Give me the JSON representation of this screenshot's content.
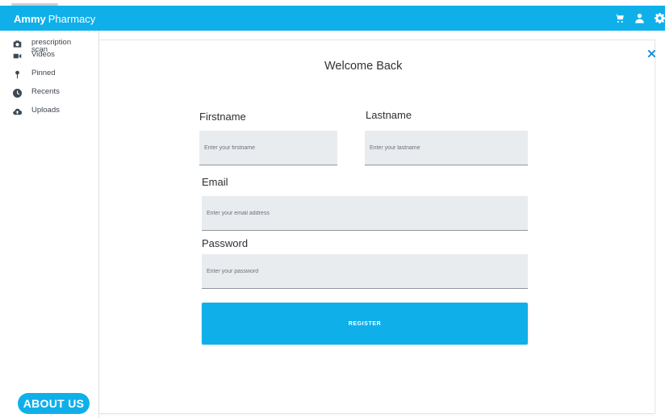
{
  "header": {
    "brand_bold": "Ammy",
    "brand_light": "Pharmacy",
    "icons": [
      "cart-icon",
      "user-icon",
      "gear-icon"
    ],
    "accent_color": "#0fb0ea"
  },
  "sidebar": {
    "items": [
      {
        "label": "prescription scan",
        "icon": "camera-icon"
      },
      {
        "label": "Videos",
        "icon": "video-icon"
      },
      {
        "label": "Pinned",
        "icon": "pin-icon"
      },
      {
        "label": "Recents",
        "icon": "clock-icon"
      },
      {
        "label": "Uploads",
        "icon": "cloud-upload-icon"
      }
    ],
    "about_label": "ABOUT US"
  },
  "form": {
    "title": "Welcome Back",
    "firstname_label": "Firstname",
    "firstname_placeholder": "Enter your firstname",
    "lastname_label": "Lastname",
    "lastname_placeholder": "Enter your lastname",
    "email_label": "Email",
    "email_placeholder": "Enter your email address",
    "password_label": "Password",
    "password_placeholder": "Enter your password",
    "submit_label": "REGISTER",
    "close_icon": "close-icon"
  }
}
